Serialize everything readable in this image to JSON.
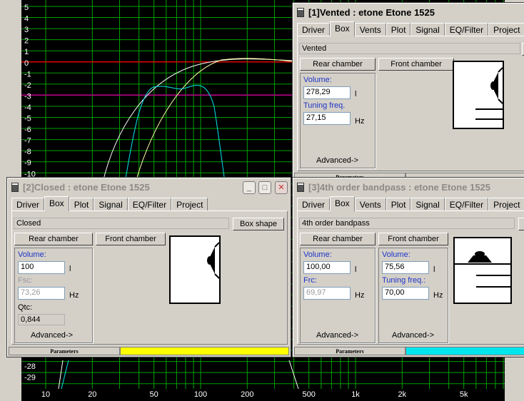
{
  "graph": {
    "y_ticks_top": [
      "5",
      "4",
      "3",
      "2",
      "1",
      "0",
      "-1",
      "-2",
      "-3",
      "-4",
      "-5",
      "-6",
      "-7",
      "-8",
      "-9",
      "-10"
    ],
    "y_ticks_bottom": [
      "-28",
      "-29"
    ],
    "x_ticks": [
      "10",
      "20",
      "50",
      "100",
      "200",
      "500",
      "1k",
      "2k",
      "5k"
    ]
  },
  "windows": [
    {
      "id": "w1",
      "title": "[1]Vented : etone Etone 1525",
      "title_state": "active",
      "tabs": [
        "Driver",
        "Box",
        "Vents",
        "Plot",
        "Signal",
        "EQ/Filter",
        "Project"
      ],
      "selected_tab": "Box",
      "box_type": "Vented",
      "rear_button": "Rear chamber",
      "front_button": "Front chamber",
      "rear": {
        "volume_label": "Volume:",
        "volume": "278,29",
        "volume_unit": "l",
        "second_label": "Tuning freq.",
        "second_value": "27,15",
        "second_unit": "Hz",
        "advanced": "Advanced->"
      },
      "status_label": "Parameters",
      "status_color": "#d4d0c8"
    },
    {
      "id": "w2",
      "title": "[2]Closed : etone Etone 1525",
      "title_state": "inactive",
      "tabs": [
        "Driver",
        "Box",
        "Plot",
        "Signal",
        "EQ/Filter",
        "Project"
      ],
      "selected_tab": "Box",
      "box_type": "Closed",
      "box_shape_button": "Box shape",
      "rear_button": "Rear chamber",
      "front_button": "Front chamber",
      "rear": {
        "volume_label": "Volume:",
        "volume": "100",
        "volume_unit": "l",
        "second_label": "Fsc:",
        "second_value": "73,26",
        "second_unit": "Hz",
        "qtc_label": "Qtc:",
        "qtc_value": "0,844",
        "advanced": "Advanced->"
      },
      "status_label": "Parameters",
      "status_color": "#ffff00"
    },
    {
      "id": "w3",
      "title": "[3]4th order bandpass : etone Etone 1525",
      "title_state": "inactive",
      "tabs": [
        "Driver",
        "Box",
        "Vents",
        "Plot",
        "Signal",
        "EQ/Filter",
        "Project"
      ],
      "selected_tab": "Box",
      "box_type": "4th order bandpass",
      "rear_button": "Rear chamber",
      "front_button": "Front chamber",
      "rear": {
        "volume_label": "Volume:",
        "volume": "100,00",
        "volume_unit": "l",
        "second_label": "Frc:",
        "second_value": "69,97",
        "second_unit": "Hz",
        "advanced": "Advanced->"
      },
      "front": {
        "volume_label": "Volume:",
        "volume": "75,56",
        "volume_unit": "l",
        "second_label": "Tuning freq.:",
        "second_value": "70,00",
        "second_unit": "Hz",
        "advanced": "Advanced->"
      },
      "status_label": "Parameters",
      "status_color": "#00e5ee"
    }
  ],
  "title_buttons": {
    "minimize": "_",
    "maximize": "□",
    "close": "✕"
  },
  "colors": {
    "graph_bg": "#000000",
    "grid": "#00a000",
    "zero_line": "#e00000",
    "ref_line": "#c00090",
    "curve_vented": "#ffffa0",
    "curve_closed": "#ffff00",
    "curve_bandpass": "#00e5ee",
    "curve_white": "#ffffff"
  }
}
